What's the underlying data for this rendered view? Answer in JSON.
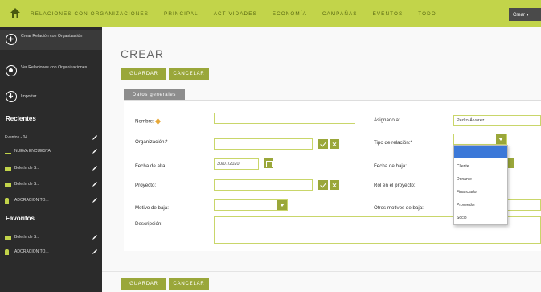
{
  "topbar": {
    "nav": [
      "RELACIONES CON ORGANIZACIONES",
      "PRINCIPAL",
      "ACTIVIDADES",
      "ECONOMÍA",
      "CAMPAÑAS",
      "EVENTOS",
      "TODO"
    ],
    "crear_label": "Crear ▾",
    "accent": "#c2d44a"
  },
  "sidebar": {
    "actions": [
      {
        "label": "Crear Relación con Organización",
        "icon": "plus-circle-icon"
      },
      {
        "label": "Ver Relaciones con Organizaciones",
        "icon": "view-circle-icon"
      },
      {
        "label": "Importar",
        "icon": "import-circle-icon"
      }
    ],
    "recientes_title": "Recientes",
    "recientes": [
      {
        "label": "Eventos - 04...",
        "icon": "none"
      },
      {
        "label": "NUEVA ENCUESTA",
        "icon": "list-icon"
      },
      {
        "label": "Boletín de S...",
        "icon": "megaphone-icon"
      },
      {
        "label": "Boletín de S...",
        "icon": "megaphone-icon"
      },
      {
        "label": "ADORACION TO...",
        "icon": "person-icon"
      }
    ],
    "favoritos_title": "Favoritos",
    "favoritos": [
      {
        "label": "Boletín de S...",
        "icon": "megaphone-icon"
      },
      {
        "label": "ADORACION TO...",
        "icon": "person-icon"
      }
    ]
  },
  "main": {
    "title": "CREAR",
    "save_label": "GUARDAR",
    "cancel_label": "CANCELAR",
    "tab_label": "Datos generales"
  },
  "form": {
    "nombre_label": "Nombre:",
    "organizacion_label": "Organización:*",
    "fecha_alta_label": "Fecha de alta:",
    "fecha_alta_value": "30/07/2020",
    "proyecto_label": "Proyecto:",
    "motivo_baja_label": "Motivo de baja:",
    "descripcion_label": "Descripción:",
    "asignado_label": "Asignado a:",
    "asignado_value": "Pedro Álvarez",
    "tipo_relacion_label": "Tipo de relación:*",
    "fecha_baja_label": "Fecha de baja:",
    "rol_label": "Rol en el proyecto:",
    "otros_motivos_label": "Otros motivos de baja:"
  },
  "tipo_options": [
    "",
    "Cliente",
    "Donante",
    "Financiador",
    "Proveedor",
    "Socio"
  ]
}
